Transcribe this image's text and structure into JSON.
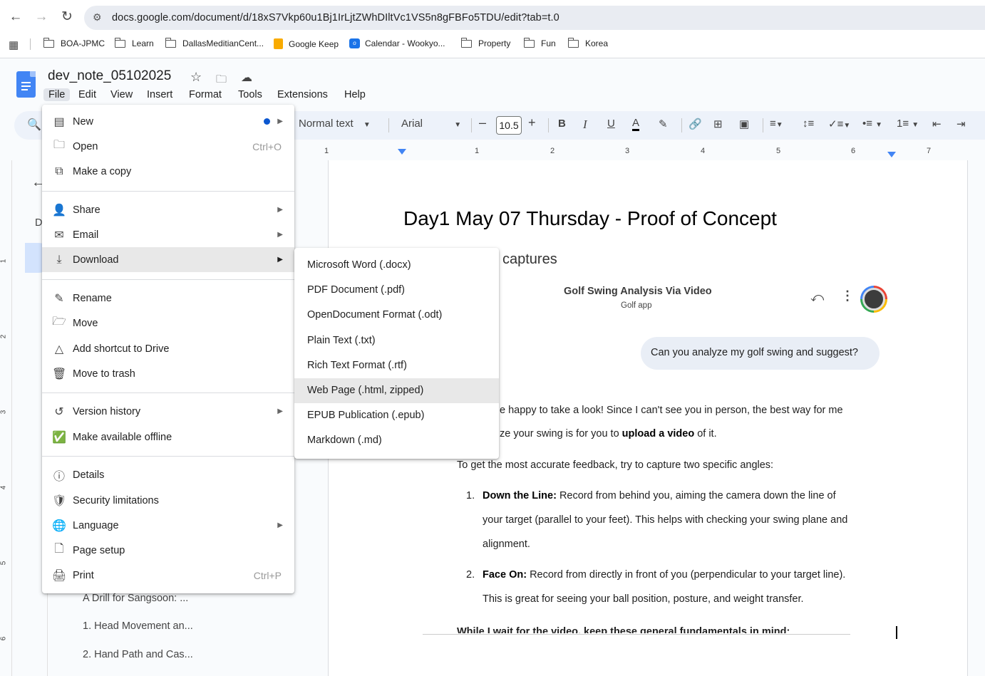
{
  "browser": {
    "url": "docs.google.com/document/d/18xS7Vkp60u1Bj1IrLjtZWhDIltVc1VS5n8gFBFo5TDU/edit?tab=t.0",
    "bookmarks": [
      {
        "label": "BOA-JPMC",
        "icon": "folder-icon"
      },
      {
        "label": "Learn",
        "icon": "folder-icon"
      },
      {
        "label": "DallasMeditianCent...",
        "icon": "folder-icon"
      },
      {
        "label": "Google Keep",
        "icon": "keep-icon"
      },
      {
        "label": "Calendar - Wookyo...",
        "icon": "calendar-icon"
      },
      {
        "label": "Property",
        "icon": "folder-icon"
      },
      {
        "label": "Fun",
        "icon": "folder-icon"
      },
      {
        "label": "Korea",
        "icon": "folder-icon"
      }
    ]
  },
  "doc": {
    "title": "dev_note_05102025",
    "menu": [
      "File",
      "Edit",
      "View",
      "Insert",
      "Format",
      "Tools",
      "Extensions",
      "Help"
    ]
  },
  "toolbar": {
    "style": "Normal text",
    "font": "Arial",
    "font_size": "10.5"
  },
  "ruler": [
    "1",
    "1",
    "2",
    "3",
    "4",
    "5",
    "6",
    "7"
  ],
  "left_ruler": [
    "1",
    "2",
    "3",
    "4",
    "5",
    "6"
  ],
  "outline": {
    "heading_letter": "D",
    "items": [
      "A Drill for Sangsoon: ...",
      "1. Head Movement an...",
      "2. Hand Path and Cas..."
    ]
  },
  "page": {
    "heading": "Day1 May 07 Thursday -  Proof of Concept",
    "captures": "captures",
    "card_title": "Golf Swing Analysis Via Video",
    "card_subtitle": "Golf app",
    "user_prompt": "Can you analyze my golf swing and suggest?",
    "para1_a": "e happy to take a look! Since I can't see you in person, the best way for me",
    "para1_b": "ze your swing is for you to ",
    "para1_bold": "upload a video",
    "para1_c": " of it.",
    "para2": "To get the most accurate feedback, try to capture two specific angles:",
    "item1_num": "1.",
    "item1_bold": "Down the Line:",
    "item1_text": " Record from behind you, aiming the camera down the line of",
    "item1_line2": "your target (parallel to your feet). This helps with checking your swing plane and",
    "item1_line3": "alignment.",
    "item2_num": "2.",
    "item2_bold": "Face On:",
    "item2_text": " Record from directly in front of you (perpendicular to your target line).",
    "item2_line2": "This is great for seeing your ball position, posture, and weight transfer.",
    "cutoff": "While I wait for the video, keep these general fundamentals in mind:"
  },
  "file_menu": {
    "new": "New",
    "open": "Open",
    "open_sc": "Ctrl+O",
    "copy": "Make a copy",
    "share": "Share",
    "email": "Email",
    "download": "Download",
    "rename": "Rename",
    "move": "Move",
    "shortcut": "Add shortcut to Drive",
    "trash": "Move to trash",
    "version": "Version history",
    "offline": "Make available offline",
    "details": "Details",
    "security": "Security limitations",
    "language": "Language",
    "page_setup": "Page setup",
    "print": "Print",
    "print_sc": "Ctrl+P"
  },
  "download_menu": [
    "Microsoft Word (.docx)",
    "PDF Document (.pdf)",
    "OpenDocument Format (.odt)",
    "Plain Text (.txt)",
    "Rich Text Format (.rtf)",
    "Web Page (.html, zipped)",
    "EPUB Publication (.epub)",
    "Markdown (.md)"
  ],
  "hovered_download_item": "Web Page (.html, zipped)"
}
